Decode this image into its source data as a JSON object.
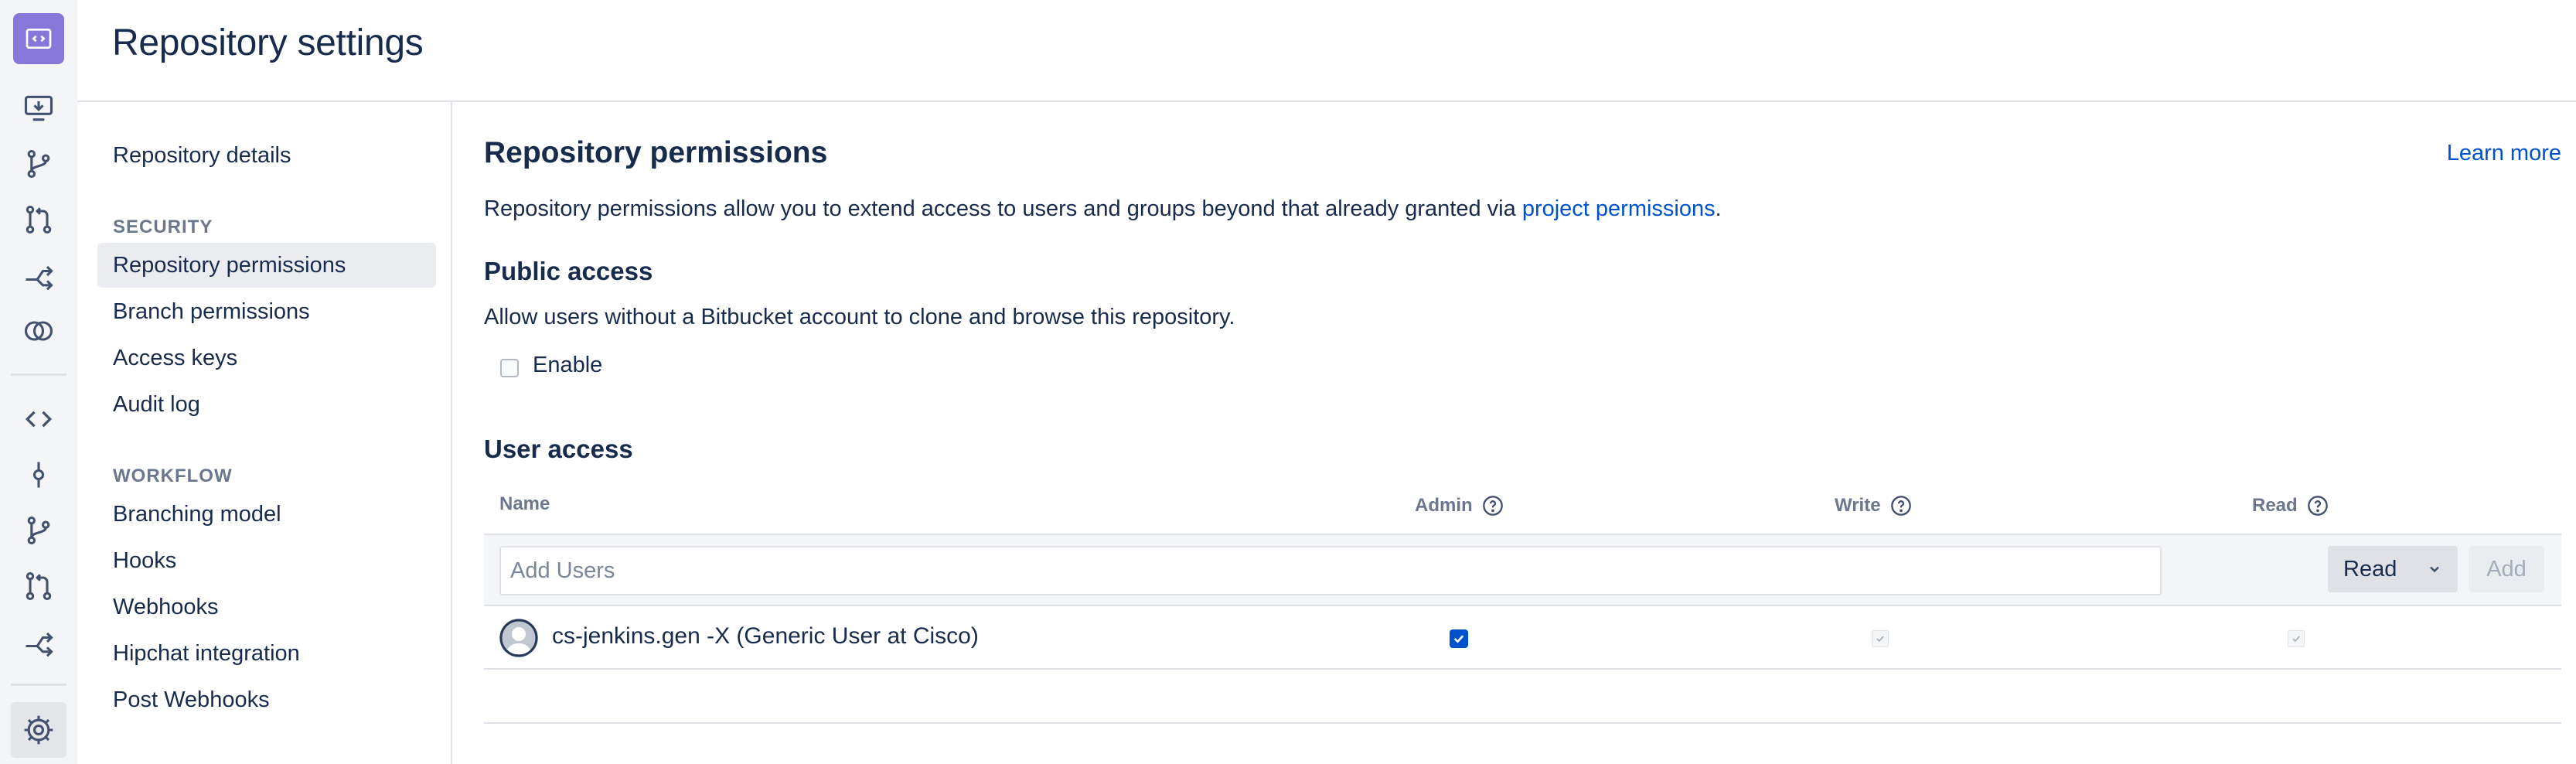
{
  "header": {
    "title": "Repository settings"
  },
  "rail": {
    "items": [
      {
        "icon": "repository-logo-icon"
      },
      {
        "icon": "clone-icon"
      },
      {
        "icon": "branches-icon"
      },
      {
        "icon": "pull-requests-icon"
      },
      {
        "icon": "forks-icon"
      },
      {
        "icon": "compare-icon"
      },
      {
        "icon": "source-icon"
      },
      {
        "icon": "commits-icon"
      },
      {
        "icon": "branches-icon"
      },
      {
        "icon": "pull-requests-icon"
      },
      {
        "icon": "forks-icon"
      },
      {
        "icon": "settings-icon"
      }
    ]
  },
  "sidebar": {
    "repository_details": "Repository details",
    "security_heading": "SECURITY",
    "security_items": [
      "Repository permissions",
      "Branch permissions",
      "Access keys",
      "Audit log"
    ],
    "workflow_heading": "WORKFLOW",
    "workflow_items": [
      "Branching model",
      "Hooks",
      "Webhooks",
      "Hipchat integration",
      "Post Webhooks"
    ]
  },
  "main": {
    "title": "Repository permissions",
    "learn_more": "Learn more",
    "description_prefix": "Repository permissions allow you to extend access to users and groups beyond that already granted via ",
    "description_link": "project permissions",
    "description_suffix": ".",
    "public_access": {
      "heading": "Public access",
      "description": "Allow users without a Bitbucket account to clone and browse this repository.",
      "enable_label": "Enable",
      "enabled": false
    },
    "user_access": {
      "heading": "User access",
      "columns": {
        "name": "Name",
        "admin": "Admin",
        "write": "Write",
        "read": "Read"
      },
      "add_placeholder": "Add Users",
      "permission_select": "Read",
      "add_button": "Add",
      "users": [
        {
          "name": "cs-jenkins.gen -X (Generic User at Cisco)",
          "admin": true,
          "write": true,
          "read": true
        }
      ]
    }
  },
  "colors": {
    "accent": "#0052cc",
    "logo": "#8777d9",
    "text": "#172b4d",
    "muted": "#6b778c"
  }
}
